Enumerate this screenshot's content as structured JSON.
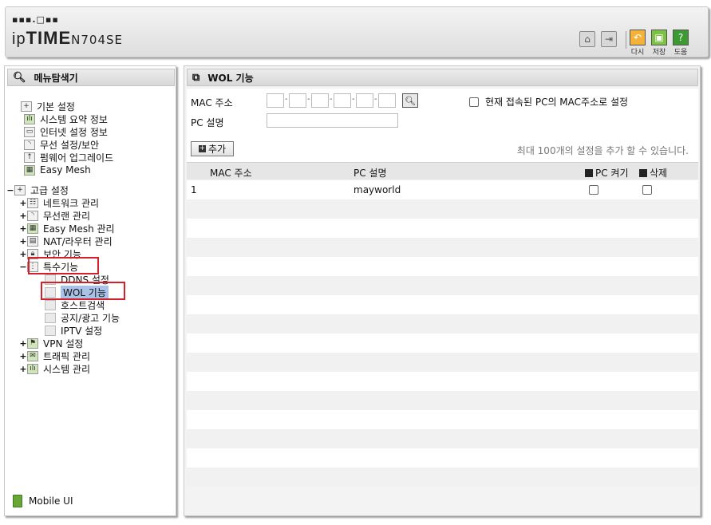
{
  "header": {
    "logo_dots": "▪▪▪.□▪▪",
    "brand_prefix": "ip",
    "brand_main": "TIME",
    "model": "N704SE",
    "buttons": [
      {
        "label": "다시",
        "icon": "undo-icon",
        "color": "#f3b23a"
      },
      {
        "label": "저장",
        "icon": "save-icon",
        "color": "#7dc242"
      },
      {
        "label": "도움",
        "icon": "help-icon",
        "color": "#3d9a33"
      }
    ]
  },
  "sidebar": {
    "title": "메뉴탐색기",
    "tree": [
      {
        "label": "기본 설정",
        "level": 0,
        "expander": ""
      },
      {
        "label": "시스템 요약 정보",
        "level": 1
      },
      {
        "label": "인터넷 설정 정보",
        "level": 1
      },
      {
        "label": "무선 설정/보안",
        "level": 1
      },
      {
        "label": "펌웨어 업그레이드",
        "level": 1
      },
      {
        "label": "Easy Mesh",
        "level": 1
      },
      {
        "label": "고급 설정",
        "level": 0,
        "expander": "−"
      },
      {
        "label": "네트워크 관리",
        "level": 1,
        "expander": "+"
      },
      {
        "label": "무선랜 관리",
        "level": 1,
        "expander": "+"
      },
      {
        "label": "Easy Mesh 관리",
        "level": 1,
        "expander": "+"
      },
      {
        "label": "NAT/라우터 관리",
        "level": 1,
        "expander": "+"
      },
      {
        "label": "보안 기능",
        "level": 1,
        "expander": "+"
      },
      {
        "label": "특수기능",
        "level": 1,
        "expander": "−"
      },
      {
        "label": "DDNS 설정",
        "level": 2
      },
      {
        "label": "WOL 기능",
        "level": 2
      },
      {
        "label": "호스트검색",
        "level": 2
      },
      {
        "label": "공지/광고 기능",
        "level": 2
      },
      {
        "label": "IPTV 설정",
        "level": 2
      },
      {
        "label": "VPN 설정",
        "level": 1,
        "expander": "+"
      },
      {
        "label": "트래픽 관리",
        "level": 1,
        "expander": "+"
      },
      {
        "label": "시스템 관리",
        "level": 1,
        "expander": "+"
      }
    ],
    "mobile_label": "Mobile UI"
  },
  "main": {
    "title": "WOL 기능",
    "mac_label": "MAC 주소",
    "pc_label": "PC 설명",
    "current_pc_checkbox_label": "현재 접속된 PC의 MAC주소로 설정",
    "add_button": "추가",
    "limit_message": "최대 100개의 설정을 추가 할 수 있습니다.",
    "columns": {
      "mac": "MAC 주소",
      "pc": "PC 설명",
      "wake": "PC 켜기",
      "delete": "삭제"
    },
    "rows": [
      {
        "index": "1",
        "pc": "mayworld",
        "wake_checked": false,
        "delete_checked": false
      }
    ]
  }
}
